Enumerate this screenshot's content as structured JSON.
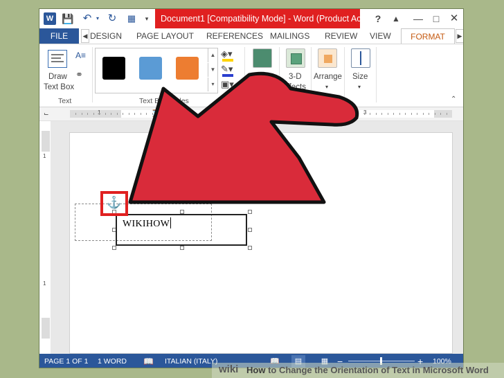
{
  "window": {
    "title": "Document1 [Compatibility Mode] - Word (Product Ac...",
    "logo_letter": "W",
    "help": "?",
    "close": "✕"
  },
  "tabs": {
    "file": "FILE",
    "items": [
      "DESIGN",
      "PAGE LAYOUT",
      "REFERENCES",
      "MAILINGS",
      "REVIEW",
      "VIEW"
    ],
    "active": "FORMAT"
  },
  "ribbon": {
    "draw_text_box_line1": "Draw",
    "draw_text_box_line2": "Text Box",
    "text_group_label": "Text",
    "styles_group_label": "Text Box Styles",
    "shadow_label_line1": "ow",
    "shadow_label_line2": "ts",
    "effects3d_line1": "3-D",
    "effects3d_line2": "Effects",
    "arrange_label": "Arrange",
    "size_label": "Size",
    "swatch_colors": [
      "#000000",
      "#5b9bd5",
      "#ed7d31"
    ]
  },
  "ruler": {
    "numbers": [
      "1",
      "1",
      "2",
      "3"
    ],
    "vertical_numbers": [
      "1",
      "1"
    ]
  },
  "document": {
    "textbox_text": "WIKIHOW",
    "anchor_icon": "anchor-icon"
  },
  "status": {
    "page": "PAGE 1 OF 1",
    "words": "1 WORD",
    "language": "ITALIAN (ITALY)",
    "zoom_out": "−",
    "zoom_in": "+",
    "zoom": "100%"
  },
  "watermark": {
    "wiki": "wiki",
    "how": "How",
    "title_rest": " to Change the Orientation of Text in Microsoft Word"
  },
  "colors": {
    "accent_blue": "#2b579a",
    "title_highlight_red": "#e02020",
    "arrow_red": "#d92b3a",
    "format_tab_orange": "#c55a11"
  }
}
